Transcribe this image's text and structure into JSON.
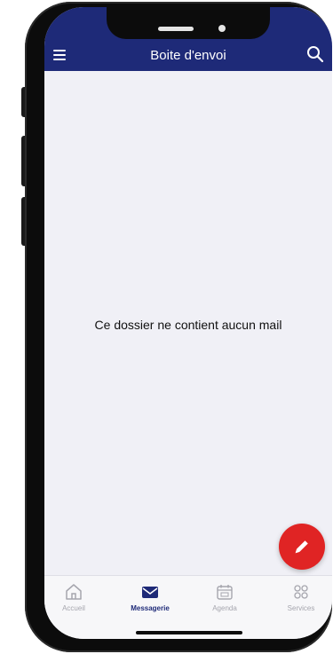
{
  "header": {
    "title": "Boite d'envoi",
    "menu_icon": "hamburger-menu-icon",
    "search_icon": "search-icon"
  },
  "main": {
    "empty_message": "Ce dossier ne contient aucun mail"
  },
  "fab": {
    "icon": "pencil-icon",
    "color": "#e02424"
  },
  "bottom_nav": {
    "items": [
      {
        "label": "Accueil",
        "icon": "home-icon",
        "active": false
      },
      {
        "label": "Messagerie",
        "icon": "envelope-icon",
        "active": true
      },
      {
        "label": "Agenda",
        "icon": "calendar-icon",
        "active": false
      },
      {
        "label": "Services",
        "icon": "grid-icon",
        "active": false
      }
    ]
  },
  "colors": {
    "brand": "#1e2a78",
    "background": "#f0f0f6",
    "inactive": "#a5a5ad"
  }
}
